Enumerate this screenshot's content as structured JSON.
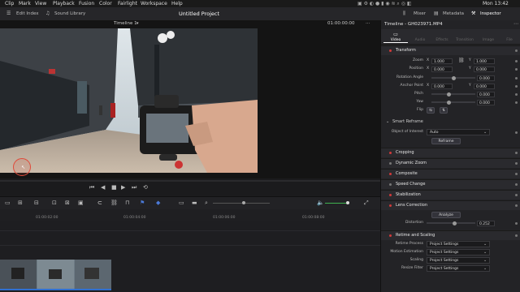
{
  "menubar": {
    "items": [
      "Clip",
      "Mark",
      "View",
      "Playback",
      "Fusion",
      "Color",
      "Fairlight",
      "Workspace",
      "Help"
    ],
    "clock": "Mon 13:42"
  },
  "toolbar": {
    "edit_index": "Edit Index",
    "sound_library": "Sound Library",
    "project_title": "Untitled Project",
    "mixer": "Mixer",
    "metadata": "Metadata",
    "inspector": "Inspector"
  },
  "viewer": {
    "timeline_name": "Timeline 1",
    "timecode": "01:00:00:00"
  },
  "ruler": {
    "ticks": [
      "01:00:02:00",
      "01:00:04:00",
      "01:00:06:00",
      "01:00:08:00"
    ]
  },
  "inspector": {
    "title": "Timeline - GH023971.MP4",
    "tabs": [
      "Video",
      "Audio",
      "Effects",
      "Transition",
      "Image",
      "File"
    ],
    "transform": {
      "label": "Transform",
      "zoom_label": "Zoom",
      "zoom_x": "1.000",
      "zoom_y": "1.000",
      "position_label": "Position",
      "position_x": "0.000",
      "position_y": "0.000",
      "rotation_label": "Rotation Angle",
      "rotation": "0.000",
      "anchor_label": "Anchor Point",
      "anchor_x": "0.000",
      "anchor_y": "0.000",
      "pitch_label": "Pitch",
      "pitch": "0.000",
      "yaw_label": "Yaw",
      "yaw": "0.000",
      "flip_label": "Flip",
      "x_label": "X",
      "y_label": "Y"
    },
    "smart_reframe": {
      "label": "Smart Reframe",
      "object_label": "Object of Interest",
      "object_value": "Auto",
      "button": "Reframe"
    },
    "sections": [
      "Cropping",
      "Dynamic Zoom",
      "Composite",
      "Speed Change",
      "Stabilization"
    ],
    "lens": {
      "label": "Lens Correction",
      "analyze": "Analyze",
      "distortion_label": "Distortion",
      "distortion": "0.252"
    },
    "retime": {
      "label": "Retime and Scaling",
      "rows": [
        {
          "label": "Retime Process",
          "value": "Project Settings"
        },
        {
          "label": "Motion Estimation",
          "value": "Project Settings"
        },
        {
          "label": "Scaling",
          "value": "Project Settings"
        },
        {
          "label": "Resize Filter",
          "value": "Project Settings"
        }
      ]
    }
  }
}
